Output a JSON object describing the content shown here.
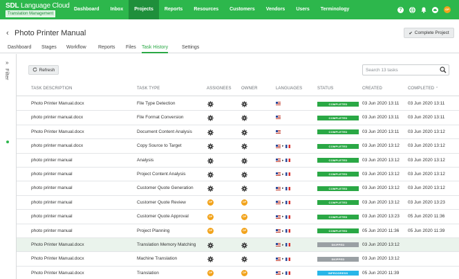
{
  "brand": {
    "title_bold": "SDL",
    "title_rest": " Language Cloud",
    "subtitle": "Translation Management"
  },
  "nav": [
    {
      "label": "Dashboard"
    },
    {
      "label": "Inbox"
    },
    {
      "label": "Projects",
      "active": true
    },
    {
      "label": "Reports"
    },
    {
      "label": "Resources"
    },
    {
      "label": "Customers"
    },
    {
      "label": "Vendors"
    },
    {
      "label": "Users"
    },
    {
      "label": "Terminology"
    }
  ],
  "user": {
    "initials": "OP"
  },
  "project": {
    "title": "Photo Printer Manual",
    "complete_label": "Complete Project"
  },
  "tabs": [
    {
      "label": "Dashboard"
    },
    {
      "label": "Stages"
    },
    {
      "label": "Workflow"
    },
    {
      "label": "Reports"
    },
    {
      "label": "Files"
    },
    {
      "label": "Task History",
      "active": true
    },
    {
      "label": "Settings"
    }
  ],
  "filter": {
    "label": "Filter"
  },
  "toolbar": {
    "refresh_label": "Refresh",
    "search_placeholder": "Search 13 tasks"
  },
  "table": {
    "headers": {
      "description": "TASK DESCRIPTION",
      "type": "TASK TYPE",
      "assignees": "ASSIGNEES",
      "owner": "OWNER",
      "languages": "LANGUAGES",
      "status": "STATUS",
      "created": "CREATED",
      "completed": "COMPLETED"
    },
    "sort": {
      "column": "completed",
      "direction": "ascending"
    },
    "rows": [
      {
        "description": "Photo Printer Manual.docx",
        "type": "File Type Detection",
        "assignee": "gear",
        "owner": "gear",
        "langs": "us",
        "status": "COMPLETED",
        "created": "03 Jun 2020 13:11",
        "completed": "03 Jun 2020 13:11"
      },
      {
        "description": "photo printer manual.docx",
        "type": "File Format Conversion",
        "assignee": "gear",
        "owner": "gear",
        "langs": "us",
        "status": "COMPLETED",
        "created": "03 Jun 2020 13:11",
        "completed": "03 Jun 2020 13:11"
      },
      {
        "description": "Photo Printer Manual.docx",
        "type": "Document Content Analysis",
        "assignee": "gear",
        "owner": "gear",
        "langs": "us",
        "status": "COMPLETED",
        "created": "03 Jun 2020 13:11",
        "completed": "03 Jun 2020 13:12"
      },
      {
        "description": "photo printer manual.docx",
        "type": "Copy Source to Target",
        "assignee": "gear",
        "owner": "gear",
        "langs": "us-fr",
        "status": "COMPLETED",
        "created": "03 Jun 2020 13:12",
        "completed": "03 Jun 2020 13:12"
      },
      {
        "description": "photo printer manual",
        "type": "Analysis",
        "assignee": "gear",
        "owner": "gear",
        "langs": "us-fr",
        "status": "COMPLETED",
        "created": "03 Jun 2020 13:12",
        "completed": "03 Jun 2020 13:12"
      },
      {
        "description": "photo printer manual",
        "type": "Project Content Analysis",
        "assignee": "gear",
        "owner": "gear",
        "langs": "us-fr",
        "status": "COMPLETED",
        "created": "03 Jun 2020 13:12",
        "completed": "03 Jun 2020 13:12"
      },
      {
        "description": "photo printer manual",
        "type": "Customer Quote Generation",
        "assignee": "gear",
        "owner": "gear",
        "langs": "us-fr",
        "status": "COMPLETED",
        "created": "03 Jun 2020 13:12",
        "completed": "03 Jun 2020 13:12"
      },
      {
        "description": "photo printer manual",
        "type": "Customer Quote Review",
        "assignee": "op",
        "owner": "op",
        "langs": "us-fr",
        "status": "COMPLETED",
        "created": "03 Jun 2020 13:12",
        "completed": "03 Jun 2020 13:23"
      },
      {
        "description": "photo printer manual",
        "type": "Customer Quote Approval",
        "assignee": "op",
        "owner": "op",
        "langs": "us-fr",
        "status": "COMPLETED",
        "created": "03 Jun 2020 13:23",
        "completed": "05 Jun 2020 11:36"
      },
      {
        "description": "photo printer manual",
        "type": "Project Planning",
        "assignee": "op",
        "owner": "op",
        "langs": "us-fr",
        "status": "COMPLETED",
        "created": "05 Jun 2020 11:36",
        "completed": "05 Jun 2020 11:39"
      },
      {
        "description": "Photo Printer Manual.docx",
        "type": "Translation Memory Matching",
        "assignee": "gear",
        "owner": "gear",
        "langs": "us-fr",
        "status": "SKIPPED",
        "created": "03 Jun 2020 13:12",
        "completed": "",
        "highlight": true
      },
      {
        "description": "Photo Printer Manual.docx",
        "type": "Machine Translation",
        "assignee": "gear",
        "owner": "gear",
        "langs": "us-fr",
        "status": "SKIPPED",
        "created": "03 Jun 2020 13:12",
        "completed": ""
      },
      {
        "description": "Photo Printer Manual.docx",
        "type": "Translation",
        "assignee": "op",
        "owner": "op",
        "langs": "us-fr",
        "status": "INPROGRESS",
        "created": "05 Jun 2020 11:39",
        "completed": ""
      }
    ]
  },
  "colors": {
    "brand_green": "#2db74c",
    "completed": "#2aa845",
    "skipped": "#9aa0a4",
    "inprogress": "#29b6e8",
    "avatar": "#f2a31b"
  }
}
